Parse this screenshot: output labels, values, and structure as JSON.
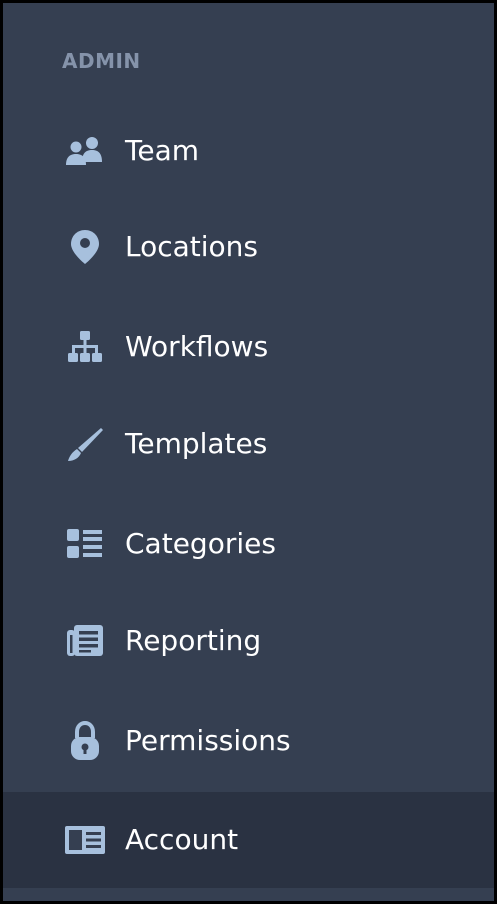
{
  "sidebar": {
    "section_title": "ADMIN",
    "items": [
      {
        "label": "Team",
        "icon": "team-icon"
      },
      {
        "label": "Locations",
        "icon": "location-pin-icon"
      },
      {
        "label": "Workflows",
        "icon": "workflow-icon"
      },
      {
        "label": "Templates",
        "icon": "brush-icon"
      },
      {
        "label": "Categories",
        "icon": "categories-list-icon"
      },
      {
        "label": "Reporting",
        "icon": "newspaper-icon"
      },
      {
        "label": "Permissions",
        "icon": "lock-icon"
      },
      {
        "label": "Account",
        "icon": "account-card-icon",
        "active": true
      }
    ]
  },
  "colors": {
    "sidebar_bg": "#353f51",
    "active_bg": "#2a3242",
    "icon": "#a7c0dd",
    "header_text": "#8593aa",
    "label_text": "#ffffff"
  }
}
